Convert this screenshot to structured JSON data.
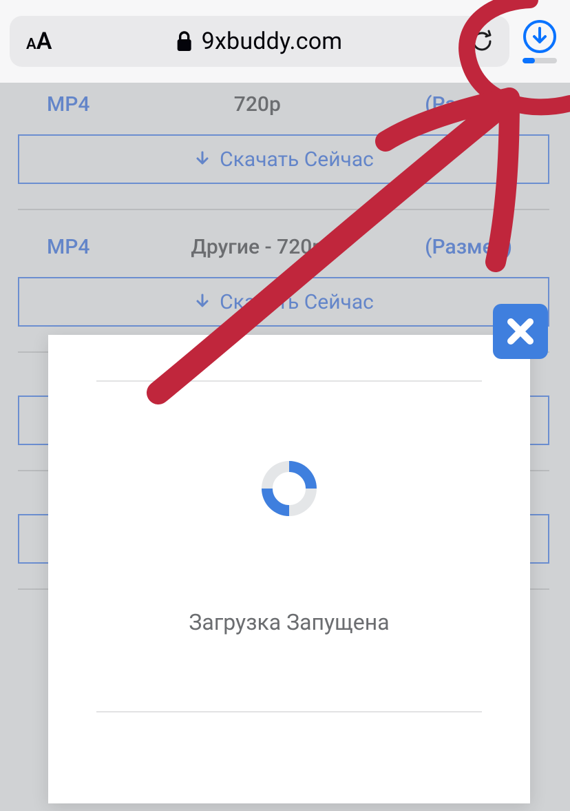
{
  "chrome": {
    "domain": "9xbuddy.com",
    "download_progress_pct": 35
  },
  "page": {
    "groups": [
      {
        "format": "MP4",
        "quality": "720p",
        "size_label": "(Размер)",
        "button_label": "Скачать Сейчас"
      },
      {
        "format": "MP4",
        "quality": "Другие - 720p",
        "size_label": "(Размер)",
        "button_label": "Скачать Сейчас"
      },
      {
        "format": "",
        "quality": "",
        "size_label": "",
        "button_label": ""
      },
      {
        "format": "",
        "quality": "",
        "size_label": "",
        "button_label": ""
      }
    ]
  },
  "modal": {
    "status_text": "Загрузка Запущена"
  }
}
